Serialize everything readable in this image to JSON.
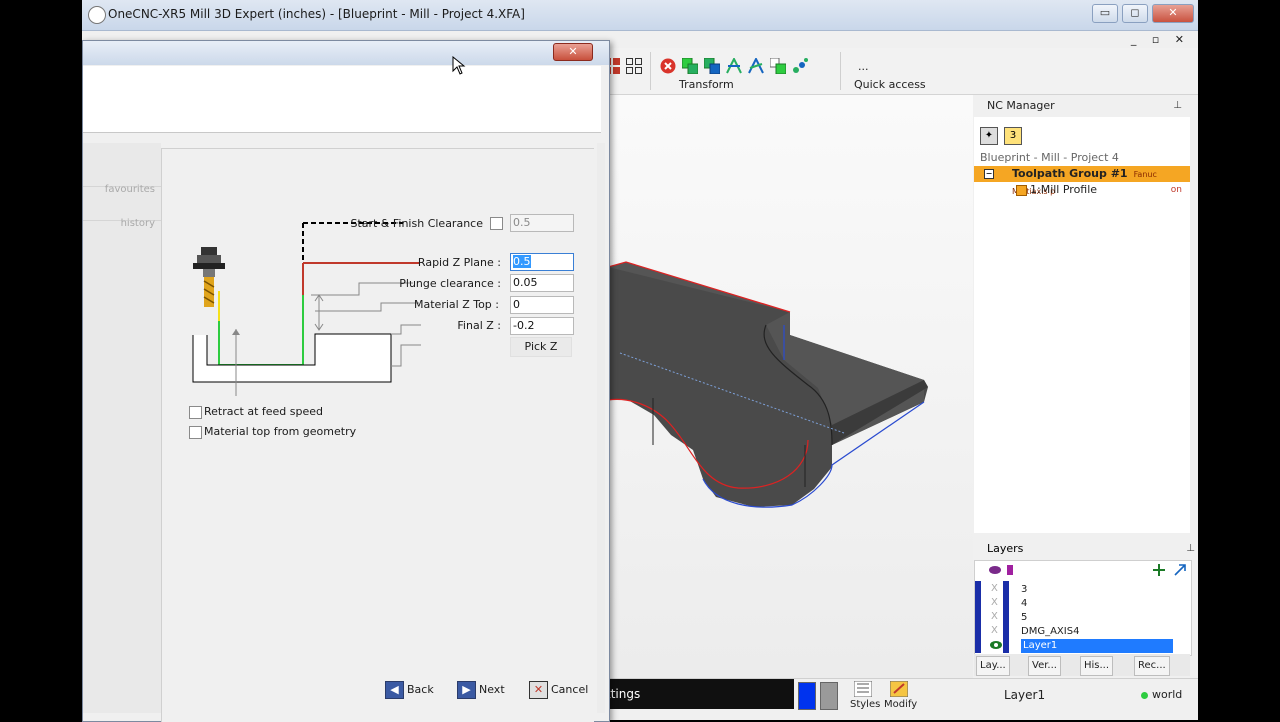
{
  "app": {
    "title": "OneCNC-XR5 Mill 3D Expert (inches) - [Blueprint - Mill - Project 4.XFA]",
    "min": "▭",
    "max": "◻",
    "close": "✕",
    "mdi_buttons": "_ ▫ ✕"
  },
  "ribbon": {
    "transform_label": "Transform",
    "quick_access_label": "Quick access",
    "quick_access_dots": "..."
  },
  "nc_manager": {
    "title": "NC Manager",
    "pin": "⊥",
    "icon2_label": "3",
    "project": "Blueprint - Mill - Project 4",
    "group_label": "Toolpath Group #1",
    "group_sub": "Fanuc Multiaxis p",
    "item_label": "1:Mill Profile",
    "item_state": "on"
  },
  "layers": {
    "title": "Layers",
    "pin": "⊥",
    "rows": [
      "3",
      "4",
      "5",
      "DMG_AXIS4",
      "Layer1"
    ],
    "hidden_mark": "X",
    "tabs": [
      "Lay...",
      "Ver...",
      "His...",
      "Rec..."
    ]
  },
  "status": {
    "dark_text": "ttings",
    "styles_label": "Styles",
    "modify_label": "Modify",
    "layer_name": "Layer1",
    "world_label": "world"
  },
  "dialog": {
    "close": "✕",
    "sidebar": {
      "favourites": "favourites",
      "history": "history"
    },
    "fields": {
      "start_finish_label": "Start & Finish Clearance",
      "start_finish_value": "0.5",
      "rapid_z_label": "Rapid Z Plane :",
      "rapid_z_value": "0.5",
      "plunge_label": "Plunge clearance :",
      "plunge_value": "0.05",
      "material_top_label": "Material Z Top :",
      "material_top_value": "0",
      "final_z_label": "Final Z :",
      "final_z_value": "-0.2",
      "pick_z": "Pick Z"
    },
    "checkboxes": {
      "retract_label": "Retract at feed speed",
      "material_geom_label": "Material top from geometry"
    },
    "buttons": {
      "back": "Back",
      "next": "Next",
      "cancel": "Cancel"
    }
  },
  "colors": {
    "group_highlight": "#f5a623",
    "selected_layer": "#1f7bff",
    "rapid_line": "#c0392b",
    "feed_line": "#2ecc40"
  }
}
